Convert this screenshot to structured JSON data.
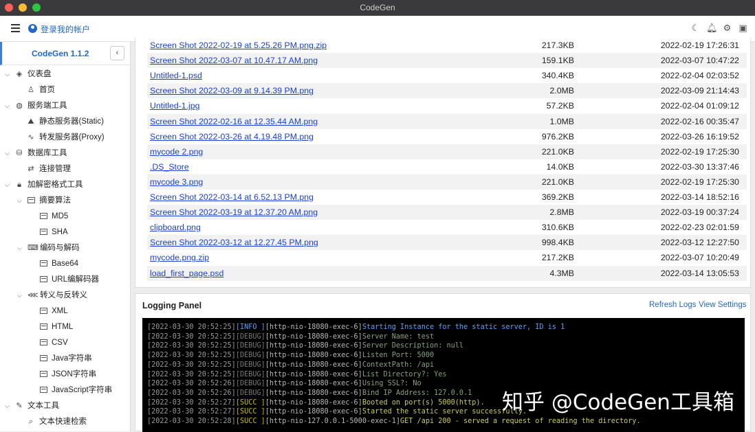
{
  "window": {
    "title": "CodeGen"
  },
  "colors": {
    "accent": "#2168c8",
    "link": "#1a40d6",
    "traffic": [
      "#fe5f57",
      "#febc2e",
      "#28c840"
    ]
  },
  "appbar": {
    "account_label": "登录我的帐户",
    "right_icons": [
      "moon-icon",
      "bell-icon",
      "gear-icon",
      "panel-icon"
    ]
  },
  "sidebar": {
    "title": "CodeGen 1.1.2",
    "items": [
      {
        "label": "仪表盘",
        "icon": "layers-icon"
      },
      {
        "label": "首页",
        "icon": "person-icon"
      },
      {
        "label": "服务端工具",
        "icon": "globe-icon"
      },
      {
        "label": "静态服务器(Static)",
        "icon": "mountain-icon"
      },
      {
        "label": "转发服务器(Proxy)",
        "icon": "pulse-icon"
      },
      {
        "label": "数据库工具",
        "icon": "database-icon"
      },
      {
        "label": "连接管理",
        "icon": "swap-icon"
      },
      {
        "label": "加解密格式工具",
        "icon": "lock-icon"
      },
      {
        "label": "摘要算法",
        "icon": "box-icon"
      },
      {
        "label": "MD5",
        "icon": "box-icon"
      },
      {
        "label": "SHA",
        "icon": "box-icon"
      },
      {
        "label": "编码与解码",
        "icon": "keyboard-icon"
      },
      {
        "label": "Base64",
        "icon": "box-icon"
      },
      {
        "label": "URL编解码器",
        "icon": "box-icon"
      },
      {
        "label": "转义与反转义",
        "icon": "share-icon"
      },
      {
        "label": "XML",
        "icon": "box-icon"
      },
      {
        "label": "HTML",
        "icon": "box-icon"
      },
      {
        "label": "CSV",
        "icon": "box-icon"
      },
      {
        "label": "Java字符串",
        "icon": "box-icon"
      },
      {
        "label": "JSON字符串",
        "icon": "box-icon"
      },
      {
        "label": "JavaScript字符串",
        "icon": "box-icon"
      },
      {
        "label": "文本工具",
        "icon": "edit-icon"
      },
      {
        "label": "文本快速检索",
        "icon": "search-icon"
      }
    ]
  },
  "files": [
    {
      "name": "Screen Shot 2022-02-19 at 5.25.26 PM.png.zip",
      "size": "217.3KB",
      "date": "2022-02-19 17:26:31"
    },
    {
      "name": "Screen Shot 2022-03-07 at 10.47.17 AM.png",
      "size": "159.1KB",
      "date": "2022-03-07 10:47:22"
    },
    {
      "name": "Untitled-1.psd",
      "size": "340.4KB",
      "date": "2022-02-04 02:03:52"
    },
    {
      "name": "Screen Shot 2022-03-09 at 9.14.39 PM.png",
      "size": "2.0MB",
      "date": "2022-03-09 21:14:43"
    },
    {
      "name": "Untitled-1.jpg",
      "size": "57.2KB",
      "date": "2022-02-04 01:09:12"
    },
    {
      "name": "Screen Shot 2022-02-16 at 12.35.44 AM.png",
      "size": "1.0MB",
      "date": "2022-02-16 00:35:47"
    },
    {
      "name": "Screen Shot 2022-03-26 at 4.19.48 PM.png",
      "size": "976.2KB",
      "date": "2022-03-26 16:19:52"
    },
    {
      "name": "mycode 2.png",
      "size": "221.0KB",
      "date": "2022-02-19 17:25:30"
    },
    {
      "name": ".DS_Store",
      "size": "14.0KB",
      "date": "2022-03-30 13:37:46"
    },
    {
      "name": "mycode 3.png",
      "size": "221.0KB",
      "date": "2022-02-19 17:25:30"
    },
    {
      "name": "Screen Shot 2022-03-14 at 6.52.13 PM.png",
      "size": "369.2KB",
      "date": "2022-03-14 18:52:16"
    },
    {
      "name": "Screen Shot 2022-03-19 at 12.37.20 AM.png",
      "size": "2.8MB",
      "date": "2022-03-19 00:37:24"
    },
    {
      "name": "clipboard.png",
      "size": "310.6KB",
      "date": "2022-02-23 02:01:59"
    },
    {
      "name": "Screen Shot 2022-03-12 at 12.27.45 PM.png",
      "size": "998.4KB",
      "date": "2022-03-12 12:27:50"
    },
    {
      "name": "mycode.png.zip",
      "size": "217.2KB",
      "date": "2022-03-07 10:20:49"
    },
    {
      "name": "load_first_page.psd",
      "size": "4.3MB",
      "date": "2022-03-14 13:05:53"
    }
  ],
  "logging": {
    "title": "Logging Panel",
    "refresh_label": "Refresh Logs",
    "settings_label": "View Settings",
    "lines": [
      {
        "time": "[2022-03-30 20:52:25]",
        "level": "[INFO ]",
        "kind": "info",
        "thread": "[http-nio-18080-exec-6]",
        "msg": "Starting Instance for the static server, ID is 1"
      },
      {
        "time": "[2022-03-30 20:52:25]",
        "level": "[DEBUG]",
        "kind": "debug",
        "thread": "[http-nio-18080-exec-6]",
        "msg": "Server Name: test"
      },
      {
        "time": "[2022-03-30 20:52:25]",
        "level": "[DEBUG]",
        "kind": "debug",
        "thread": "[http-nio-18080-exec-6]",
        "msg": "Server Description: null"
      },
      {
        "time": "[2022-03-30 20:52:25]",
        "level": "[DEBUG]",
        "kind": "debug",
        "thread": "[http-nio-18080-exec-6]",
        "msg": "Listen Port: 5000"
      },
      {
        "time": "[2022-03-30 20:52:25]",
        "level": "[DEBUG]",
        "kind": "debug",
        "thread": "[http-nio-18080-exec-6]",
        "msg": "ContextPath: /api"
      },
      {
        "time": "[2022-03-30 20:52:25]",
        "level": "[DEBUG]",
        "kind": "debug",
        "thread": "[http-nio-18080-exec-6]",
        "msg": "List Directory?: Yes"
      },
      {
        "time": "[2022-03-30 20:52:26]",
        "level": "[DEBUG]",
        "kind": "debug",
        "thread": "[http-nio-18080-exec-6]",
        "msg": "Using SSL?: No"
      },
      {
        "time": "[2022-03-30 20:52:26]",
        "level": "[DEBUG]",
        "kind": "debug",
        "thread": "[http-nio-18080-exec-6]",
        "msg": "Bind IP Address: 127.0.0.1"
      },
      {
        "time": "[2022-03-30 20:52:27]",
        "level": "[SUCC ]",
        "kind": "succ",
        "thread": "[http-nio-18080-exec-6]",
        "msg": "Booted on port(s) 5000(http)."
      },
      {
        "time": "[2022-03-30 20:52:27]",
        "level": "[SUCC ]",
        "kind": "succ",
        "thread": "[http-nio-18080-exec-6]",
        "msg": "Started the static server successfully."
      },
      {
        "time": "[2022-03-30 20:52:28]",
        "level": "[SUCC ]",
        "kind": "succ",
        "thread": "[http-nio-127.0.0.1-5000-exec-1]",
        "msg": "GET /api 200 - served a request of reading the directory."
      }
    ]
  },
  "watermark": "知乎 @CodeGen工具箱"
}
